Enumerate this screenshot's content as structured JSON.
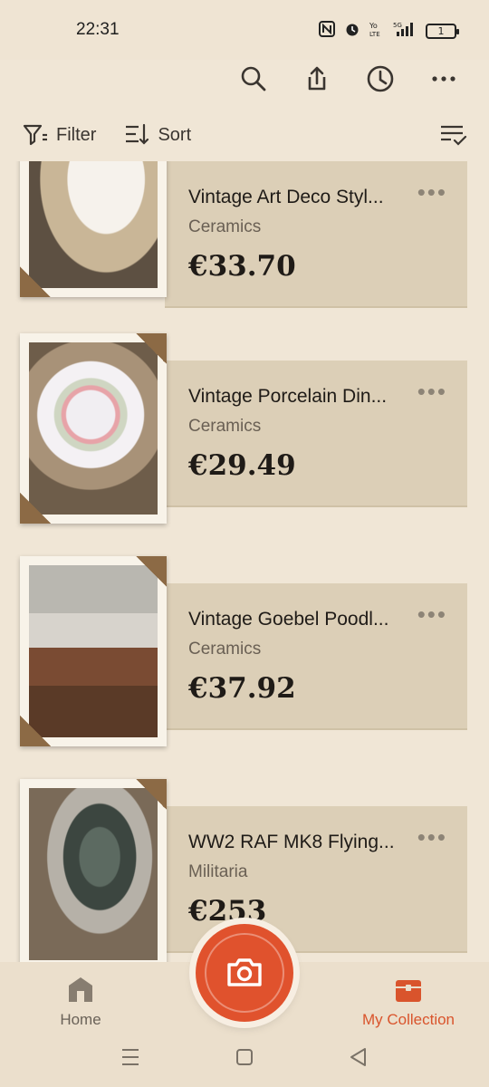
{
  "status_bar": {
    "time": "22:31",
    "icons": [
      "nfc-icon",
      "alarm-icon",
      "volte-icon",
      "5g-signal-icon"
    ],
    "battery_level": "1"
  },
  "top_actions": [
    "search-icon",
    "share-icon",
    "history-icon",
    "more-icon"
  ],
  "toolbar": {
    "filter_label": "Filter",
    "sort_label": "Sort",
    "view_icon": "checklist-icon"
  },
  "items": [
    {
      "title": "Vintage Art Deco Styl...",
      "category": "Ceramics",
      "price": "€33.70"
    },
    {
      "title": "Vintage Porcelain Din...",
      "category": "Ceramics",
      "price": "€29.49"
    },
    {
      "title": "Vintage Goebel Poodl...",
      "category": "Ceramics",
      "price": "€37.92"
    },
    {
      "title": "WW2 RAF MK8 Flying...",
      "category": "Militaria",
      "price": "€253"
    }
  ],
  "bottom_nav": {
    "home_label": "Home",
    "collection_label": "My Collection"
  },
  "colors": {
    "accent": "#e0522d",
    "background": "#f0e6d6",
    "card": "#dccfb7"
  }
}
